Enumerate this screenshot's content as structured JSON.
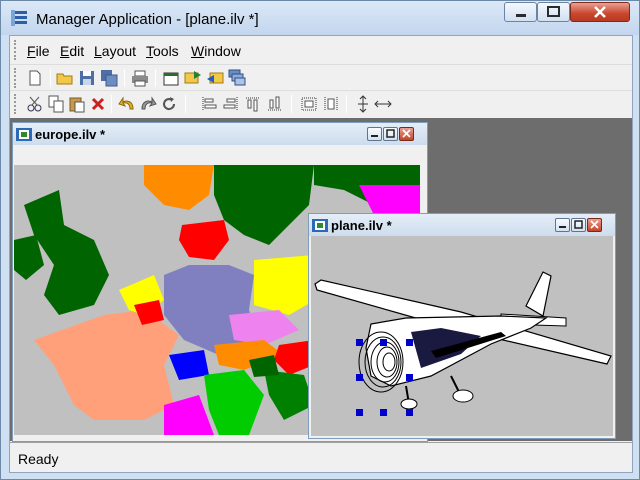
{
  "window": {
    "title": "Manager Application - [plane.ilv *]"
  },
  "menubar": {
    "items": [
      {
        "pre": "",
        "u": "F",
        "post": "ile"
      },
      {
        "pre": "",
        "u": "E",
        "post": "dit"
      },
      {
        "pre": "",
        "u": "L",
        "post": "ayout"
      },
      {
        "pre": "",
        "u": "T",
        "post": "ools"
      },
      {
        "pre": "",
        "u": "W",
        "post": "indow"
      }
    ]
  },
  "toolbar1": {
    "icons": [
      "new-file-icon",
      "open-folder-icon",
      "save-icon",
      "save-all-icon",
      "print-icon",
      "new-layer-icon",
      "move-up-icon",
      "move-down-icon",
      "stack-icon"
    ]
  },
  "toolbar2": {
    "icons": [
      "cut-icon",
      "copy-icon",
      "paste-icon",
      "delete-icon",
      "undo-icon",
      "redo-icon",
      "refresh-icon",
      "align-left-icon",
      "align-right-icon",
      "align-top-icon",
      "align-bottom-icon",
      "distribute-h-icon",
      "distribute-v-icon",
      "same-height-icon",
      "same-width-icon"
    ]
  },
  "documents": [
    {
      "title": "europe.ilv *"
    },
    {
      "title": "plane.ilv *"
    }
  ],
  "status": {
    "text": "Ready"
  },
  "colors": {
    "canvas": "#c0c0c0",
    "mdi": "#6d6d6d",
    "selection_handle": "#0000cc"
  }
}
